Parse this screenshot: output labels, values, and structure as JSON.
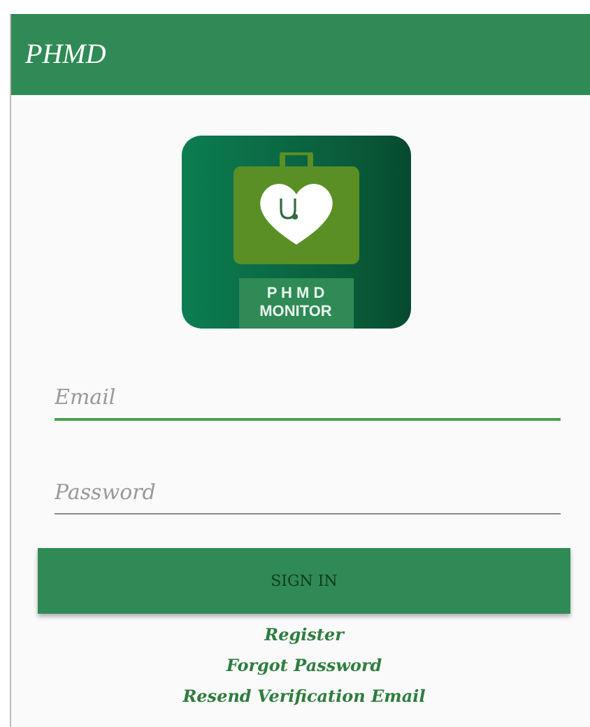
{
  "app_bar": {
    "title": "PHMD"
  },
  "logo": {
    "line_1": "P H M D",
    "line_2": "MONITOR"
  },
  "fields": [
    {
      "placeholder": "Email",
      "focused": true
    },
    {
      "placeholder": "Password",
      "focused": false
    }
  ],
  "sign_in_button": "SIGN IN",
  "links": [
    "Register",
    "Forgot Password",
    "Resend Verification Email"
  ]
}
